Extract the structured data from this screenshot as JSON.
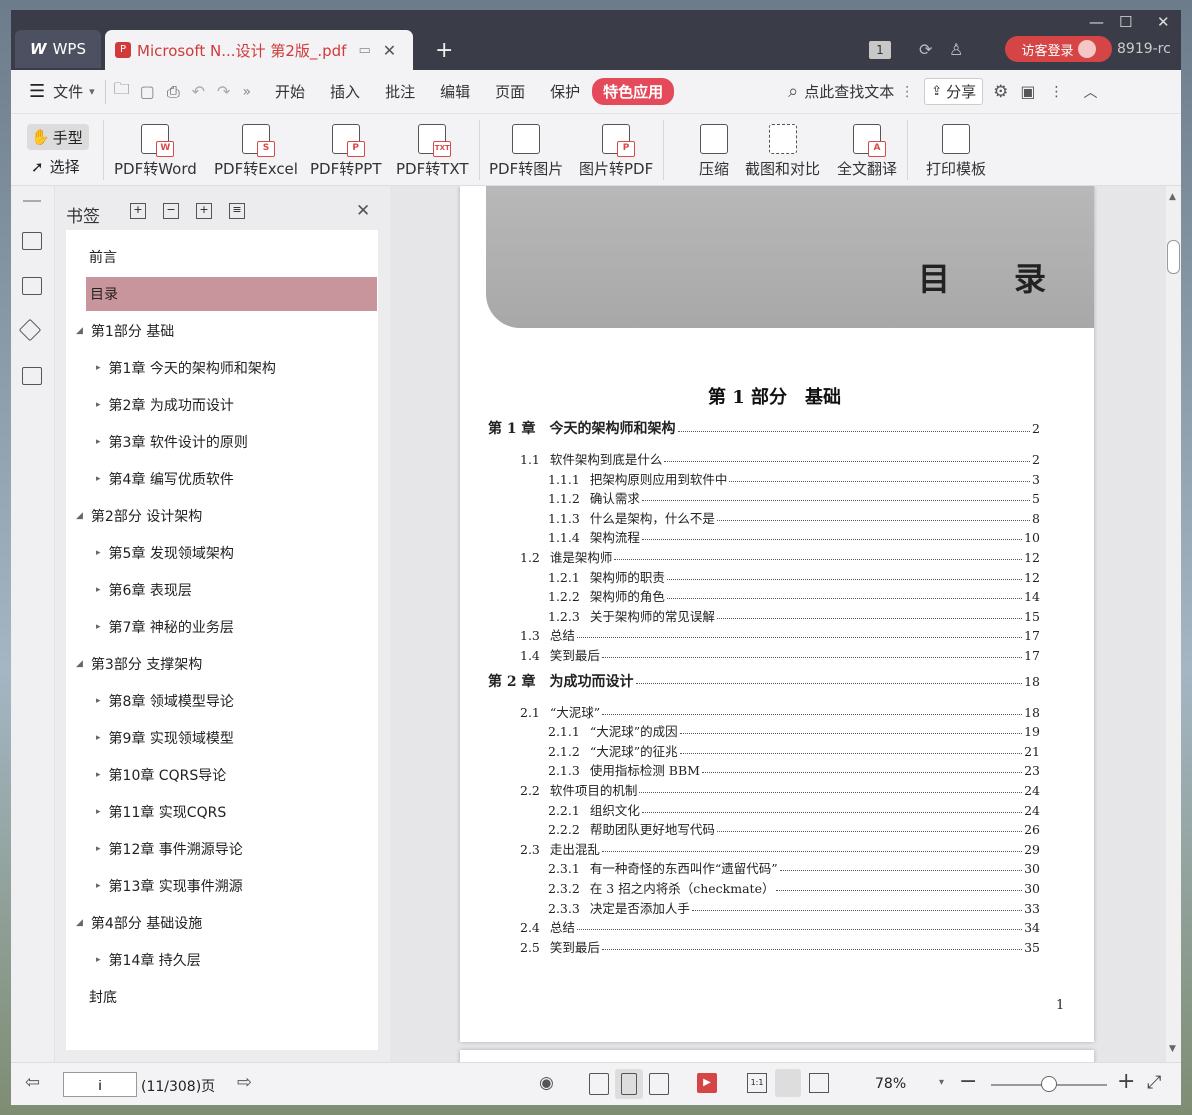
{
  "window": {
    "controls": {
      "min": "—",
      "max": "☐",
      "close": "✕"
    }
  },
  "tabs": {
    "wps_label": "WPS",
    "doc_title": "Microsoft N...设计 第2版_.pdf",
    "badge_count": "1",
    "login_label": "访客登录",
    "version": "8919-rc"
  },
  "menu": {
    "file_label": "文件",
    "items": [
      "开始",
      "插入",
      "批注",
      "编辑",
      "页面",
      "保护"
    ],
    "special_label": "特色应用",
    "search_label": "点此查找文本",
    "share_label": "分享"
  },
  "toolbar": {
    "hand_label": "手型",
    "select_label": "选择",
    "tools": [
      {
        "label": "PDF转Word",
        "badge": "W"
      },
      {
        "label": "PDF转Excel",
        "badge": "S"
      },
      {
        "label": "PDF转PPT",
        "badge": "P"
      },
      {
        "label": "PDF转TXT",
        "badge": "TXT"
      },
      {
        "label": "PDF转图片",
        "badge": ""
      },
      {
        "label": "图片转PDF",
        "badge": "P"
      },
      {
        "label": "压缩",
        "badge": ""
      },
      {
        "label": "截图和对比",
        "badge": ""
      },
      {
        "label": "全文翻译",
        "badge": "A"
      },
      {
        "label": "打印模板",
        "badge": ""
      }
    ]
  },
  "bookmarks": {
    "title": "书签",
    "items": [
      {
        "label": "前言",
        "level": 0,
        "expand": ""
      },
      {
        "label": "目录",
        "level": 0,
        "expand": "",
        "selected": true
      },
      {
        "label": "第1部分 基础",
        "level": 0,
        "expand": "open"
      },
      {
        "label": "第1章 今天的架构师和架构",
        "level": 1,
        "expand": "closed"
      },
      {
        "label": "第2章 为成功而设计",
        "level": 1,
        "expand": "closed"
      },
      {
        "label": "第3章 软件设计的原则",
        "level": 1,
        "expand": "closed"
      },
      {
        "label": "第4章 编写优质软件",
        "level": 1,
        "expand": "closed"
      },
      {
        "label": "第2部分 设计架构",
        "level": 0,
        "expand": "open"
      },
      {
        "label": "第5章 发现领域架构",
        "level": 1,
        "expand": "closed"
      },
      {
        "label": "第6章 表现层",
        "level": 1,
        "expand": "closed"
      },
      {
        "label": "第7章 神秘的业务层",
        "level": 1,
        "expand": "closed"
      },
      {
        "label": "第3部分 支撑架构",
        "level": 0,
        "expand": "open"
      },
      {
        "label": "第8章 领域模型导论",
        "level": 1,
        "expand": "closed"
      },
      {
        "label": "第9章 实现领域模型",
        "level": 1,
        "expand": "closed"
      },
      {
        "label": "第10章 CQRS导论",
        "level": 1,
        "expand": "closed"
      },
      {
        "label": "第11章 实现CQRS",
        "level": 1,
        "expand": "closed"
      },
      {
        "label": "第12章 事件溯源导论",
        "level": 1,
        "expand": "closed"
      },
      {
        "label": "第13章 实现事件溯源",
        "level": 1,
        "expand": "closed"
      },
      {
        "label": "第4部分 基础设施",
        "level": 0,
        "expand": "open"
      },
      {
        "label": "第14章 持久层",
        "level": 1,
        "expand": "closed"
      },
      {
        "label": "封底",
        "level": 0,
        "expand": ""
      }
    ]
  },
  "document": {
    "page_heading": "目　　录",
    "part_title": "第 1 部分　基础",
    "page_number": "1",
    "toc": [
      {
        "kind": "chapter",
        "num": "第 1 章",
        "title": "今天的架构师和架构",
        "page": "2"
      },
      {
        "kind": "section",
        "num": "1.1",
        "title": "软件架构到底是什么",
        "page": "2"
      },
      {
        "kind": "sub",
        "num": "1.1.1",
        "title": "把架构原则应用到软件中",
        "page": "3"
      },
      {
        "kind": "sub",
        "num": "1.1.2",
        "title": "确认需求",
        "page": "5"
      },
      {
        "kind": "sub",
        "num": "1.1.3",
        "title": "什么是架构，什么不是",
        "page": "8"
      },
      {
        "kind": "sub",
        "num": "1.1.4",
        "title": "架构流程",
        "page": "10"
      },
      {
        "kind": "section",
        "num": "1.2",
        "title": "谁是架构师",
        "page": "12"
      },
      {
        "kind": "sub",
        "num": "1.2.1",
        "title": "架构师的职责",
        "page": "12"
      },
      {
        "kind": "sub",
        "num": "1.2.2",
        "title": "架构师的角色",
        "page": "14"
      },
      {
        "kind": "sub",
        "num": "1.2.3",
        "title": "关于架构师的常见误解",
        "page": "15"
      },
      {
        "kind": "section",
        "num": "1.3",
        "title": "总结",
        "page": "17"
      },
      {
        "kind": "section",
        "num": "1.4",
        "title": "笑到最后",
        "page": "17"
      },
      {
        "kind": "chapter",
        "num": "第 2 章",
        "title": "为成功而设计",
        "page": "18"
      },
      {
        "kind": "section",
        "num": "2.1",
        "title": "“大泥球”",
        "page": "18"
      },
      {
        "kind": "sub",
        "num": "2.1.1",
        "title": "“大泥球”的成因",
        "page": "19"
      },
      {
        "kind": "sub",
        "num": "2.1.2",
        "title": "“大泥球”的征兆",
        "page": "21"
      },
      {
        "kind": "sub",
        "num": "2.1.3",
        "title": "使用指标检测 BBM",
        "page": "23"
      },
      {
        "kind": "section",
        "num": "2.2",
        "title": "软件项目的机制",
        "page": "24"
      },
      {
        "kind": "sub",
        "num": "2.2.1",
        "title": "组织文化",
        "page": "24"
      },
      {
        "kind": "sub",
        "num": "2.2.2",
        "title": "帮助团队更好地写代码",
        "page": "26"
      },
      {
        "kind": "section",
        "num": "2.3",
        "title": "走出混乱",
        "page": "29"
      },
      {
        "kind": "sub",
        "num": "2.3.1",
        "title": "有一种奇怪的东西叫作“遗留代码”",
        "page": "30"
      },
      {
        "kind": "sub",
        "num": "2.3.2",
        "title": "在 3 招之内将杀（checkmate）",
        "page": "30"
      },
      {
        "kind": "sub",
        "num": "2.3.3",
        "title": "决定是否添加人手",
        "page": "33"
      },
      {
        "kind": "section",
        "num": "2.4",
        "title": "总结",
        "page": "34"
      },
      {
        "kind": "section",
        "num": "2.5",
        "title": "笑到最后",
        "page": "35"
      }
    ]
  },
  "status": {
    "page_input": "i",
    "page_info": "(11/308)页",
    "zoom": "78%",
    "zoom_fraction": 0.5
  },
  "colors": {
    "accent": "#e54a5a",
    "selected_bookmark": "#c9959c",
    "titlebar": "#3a3d47"
  }
}
